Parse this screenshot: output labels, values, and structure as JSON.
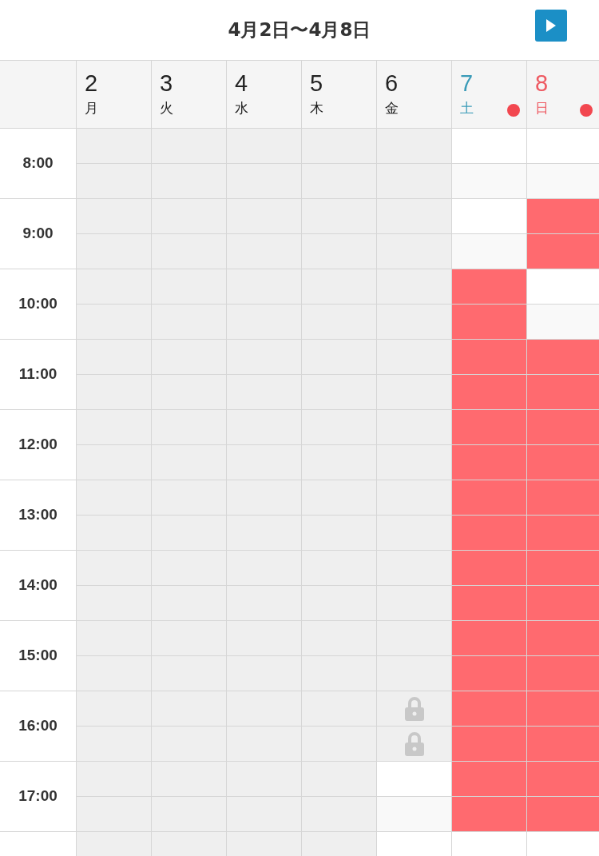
{
  "title": "4月2日〜4月8日",
  "times": [
    "8:00",
    "9:00",
    "10:00",
    "11:00",
    "12:00",
    "13:00",
    "14:00",
    "15:00",
    "16:00",
    "17:00"
  ],
  "days": [
    {
      "date": "2",
      "weekday": "月",
      "color": "#222222",
      "marked": false,
      "slots": [
        {
          "kind": "closed"
        },
        {
          "kind": "closed"
        },
        {
          "kind": "closed"
        },
        {
          "kind": "closed"
        },
        {
          "kind": "closed"
        },
        {
          "kind": "closed"
        },
        {
          "kind": "closed"
        },
        {
          "kind": "closed"
        },
        {
          "kind": "closed"
        },
        {
          "kind": "closed"
        },
        {
          "kind": "closed"
        },
        {
          "kind": "closed"
        },
        {
          "kind": "closed"
        },
        {
          "kind": "closed"
        },
        {
          "kind": "closed"
        },
        {
          "kind": "closed"
        },
        {
          "kind": "closed"
        },
        {
          "kind": "closed"
        },
        {
          "kind": "closed"
        },
        {
          "kind": "closed"
        },
        {
          "kind": "closed"
        }
      ]
    },
    {
      "date": "3",
      "weekday": "火",
      "color": "#222222",
      "marked": false,
      "slots": [
        {
          "kind": "closed"
        },
        {
          "kind": "closed"
        },
        {
          "kind": "closed"
        },
        {
          "kind": "closed"
        },
        {
          "kind": "closed"
        },
        {
          "kind": "closed"
        },
        {
          "kind": "closed"
        },
        {
          "kind": "closed"
        },
        {
          "kind": "closed"
        },
        {
          "kind": "closed"
        },
        {
          "kind": "closed"
        },
        {
          "kind": "closed"
        },
        {
          "kind": "closed"
        },
        {
          "kind": "closed"
        },
        {
          "kind": "closed"
        },
        {
          "kind": "closed"
        },
        {
          "kind": "closed"
        },
        {
          "kind": "closed"
        },
        {
          "kind": "closed"
        },
        {
          "kind": "closed"
        },
        {
          "kind": "closed"
        }
      ]
    },
    {
      "date": "4",
      "weekday": "水",
      "color": "#222222",
      "marked": false,
      "slots": [
        {
          "kind": "closed"
        },
        {
          "kind": "closed"
        },
        {
          "kind": "closed"
        },
        {
          "kind": "closed"
        },
        {
          "kind": "closed"
        },
        {
          "kind": "closed"
        },
        {
          "kind": "closed"
        },
        {
          "kind": "closed"
        },
        {
          "kind": "closed"
        },
        {
          "kind": "closed"
        },
        {
          "kind": "closed"
        },
        {
          "kind": "closed"
        },
        {
          "kind": "closed"
        },
        {
          "kind": "closed"
        },
        {
          "kind": "closed"
        },
        {
          "kind": "closed"
        },
        {
          "kind": "closed"
        },
        {
          "kind": "closed"
        },
        {
          "kind": "closed"
        },
        {
          "kind": "closed"
        },
        {
          "kind": "closed"
        }
      ]
    },
    {
      "date": "5",
      "weekday": "木",
      "color": "#222222",
      "marked": false,
      "slots": [
        {
          "kind": "closed"
        },
        {
          "kind": "closed"
        },
        {
          "kind": "closed"
        },
        {
          "kind": "closed"
        },
        {
          "kind": "closed"
        },
        {
          "kind": "closed"
        },
        {
          "kind": "closed"
        },
        {
          "kind": "closed"
        },
        {
          "kind": "closed"
        },
        {
          "kind": "closed"
        },
        {
          "kind": "closed"
        },
        {
          "kind": "closed"
        },
        {
          "kind": "closed"
        },
        {
          "kind": "closed"
        },
        {
          "kind": "closed"
        },
        {
          "kind": "closed"
        },
        {
          "kind": "closed"
        },
        {
          "kind": "closed"
        },
        {
          "kind": "closed"
        },
        {
          "kind": "closed"
        },
        {
          "kind": "closed"
        }
      ]
    },
    {
      "date": "6",
      "weekday": "金",
      "color": "#222222",
      "marked": false,
      "slots": [
        {
          "kind": "closed"
        },
        {
          "kind": "closed"
        },
        {
          "kind": "closed"
        },
        {
          "kind": "closed"
        },
        {
          "kind": "closed"
        },
        {
          "kind": "closed"
        },
        {
          "kind": "closed"
        },
        {
          "kind": "closed"
        },
        {
          "kind": "closed"
        },
        {
          "kind": "closed"
        },
        {
          "kind": "closed"
        },
        {
          "kind": "closed"
        },
        {
          "kind": "closed"
        },
        {
          "kind": "closed"
        },
        {
          "kind": "closed"
        },
        {
          "kind": "closed"
        },
        {
          "kind": "locked"
        },
        {
          "kind": "locked"
        },
        {
          "kind": "open"
        },
        {
          "kind": "open"
        },
        {
          "kind": "open"
        }
      ]
    },
    {
      "date": "7",
      "weekday": "土",
      "color": "#3a9bb8",
      "marked": true,
      "slots": [
        {
          "kind": "open"
        },
        {
          "kind": "open"
        },
        {
          "kind": "open"
        },
        {
          "kind": "open"
        },
        {
          "kind": "booked"
        },
        {
          "kind": "booked"
        },
        {
          "kind": "booked"
        },
        {
          "kind": "booked"
        },
        {
          "kind": "booked"
        },
        {
          "kind": "booked"
        },
        {
          "kind": "booked"
        },
        {
          "kind": "booked"
        },
        {
          "kind": "booked"
        },
        {
          "kind": "booked"
        },
        {
          "kind": "booked"
        },
        {
          "kind": "booked"
        },
        {
          "kind": "booked"
        },
        {
          "kind": "booked"
        },
        {
          "kind": "booked"
        },
        {
          "kind": "booked"
        },
        {
          "kind": "open"
        }
      ]
    },
    {
      "date": "8",
      "weekday": "日",
      "color": "#ee5a62",
      "marked": true,
      "slots": [
        {
          "kind": "open"
        },
        {
          "kind": "open"
        },
        {
          "kind": "booked"
        },
        {
          "kind": "booked"
        },
        {
          "kind": "open"
        },
        {
          "kind": "open"
        },
        {
          "kind": "booked"
        },
        {
          "kind": "booked"
        },
        {
          "kind": "booked"
        },
        {
          "kind": "booked"
        },
        {
          "kind": "booked"
        },
        {
          "kind": "booked"
        },
        {
          "kind": "booked"
        },
        {
          "kind": "booked"
        },
        {
          "kind": "booked"
        },
        {
          "kind": "booked"
        },
        {
          "kind": "booked"
        },
        {
          "kind": "booked"
        },
        {
          "kind": "booked"
        },
        {
          "kind": "booked"
        },
        {
          "kind": "open"
        }
      ]
    }
  ]
}
